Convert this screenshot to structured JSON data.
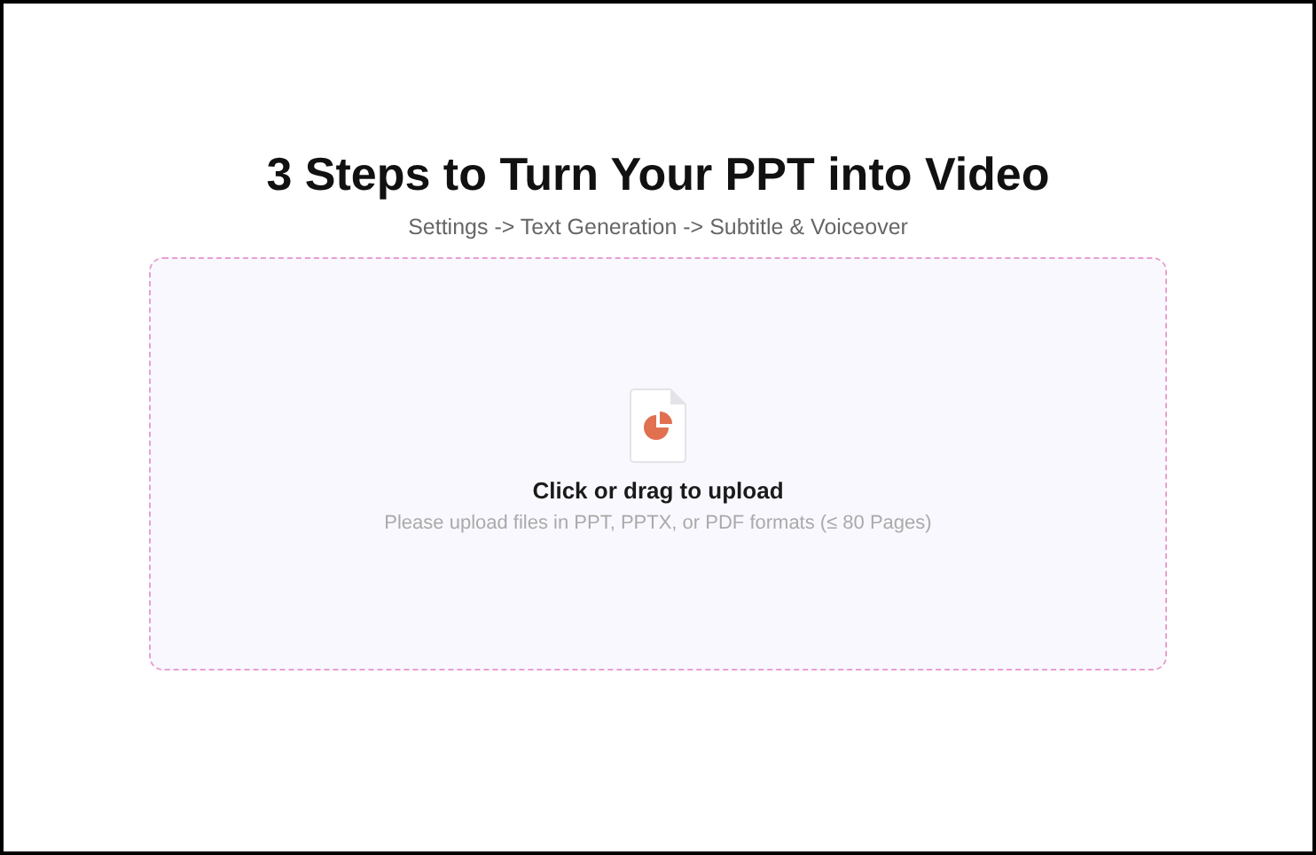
{
  "title": "3 Steps to Turn Your PPT into Video",
  "subtitle": "Settings -> Text Generation -> Subtitle & Voiceover",
  "upload": {
    "label": "Click or drag to upload",
    "hint": "Please upload files in PPT, PPTX, or PDF formats (≤ 80 Pages)"
  }
}
